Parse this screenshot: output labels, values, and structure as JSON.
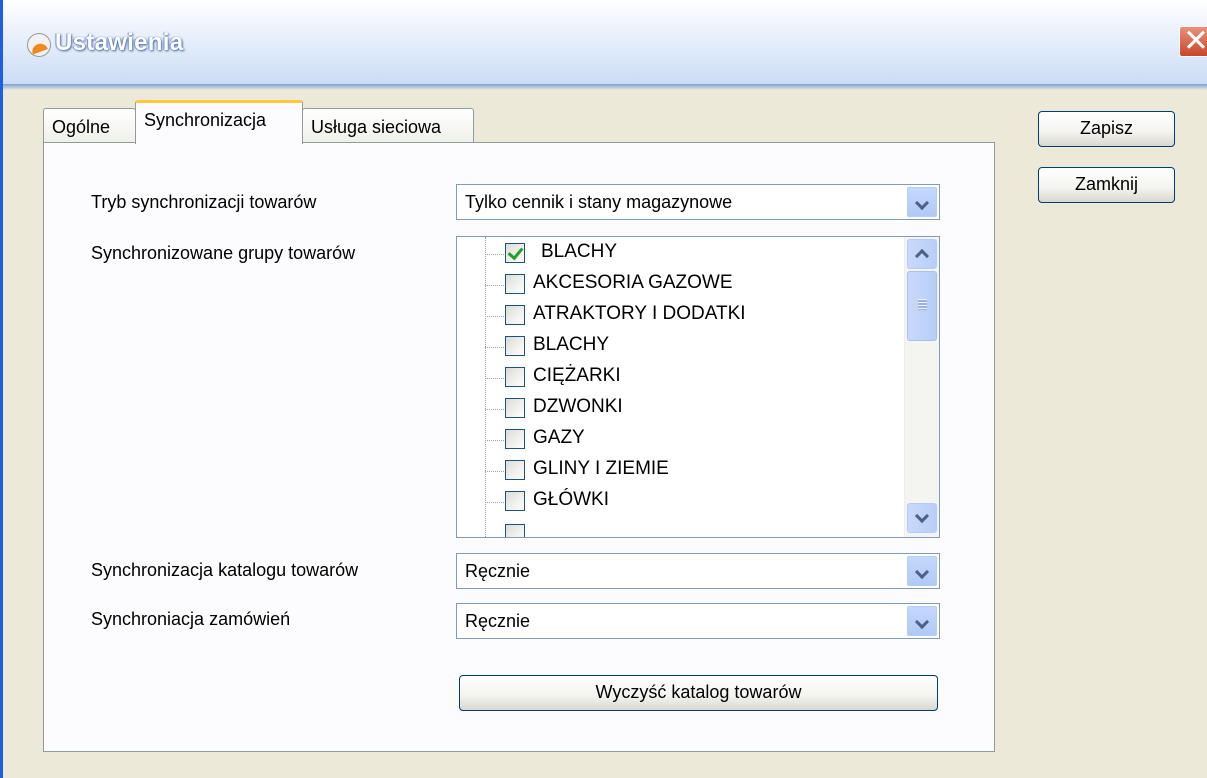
{
  "window": {
    "title": "Ustawienia",
    "close_glyph": "✕"
  },
  "tabs": [
    {
      "label": "Ogólne"
    },
    {
      "label": "Synchronizacja",
      "selected": true
    },
    {
      "label": "Usługa sieciowa"
    }
  ],
  "form": {
    "sync_mode": {
      "label": "Tryb synchronizacji towarów",
      "value": "Tylko cennik i stany magazynowe"
    },
    "groups": {
      "label": "Synchronizowane grupy towarów",
      "items": [
        {
          "label": "BLACHY",
          "checked": true
        },
        {
          "label": "AKCESORIA GAZOWE",
          "checked": false
        },
        {
          "label": "ATRAKTORY I DODATKI",
          "checked": false
        },
        {
          "label": "BLACHY",
          "checked": false
        },
        {
          "label": "CIĘŻARKI",
          "checked": false
        },
        {
          "label": "DZWONKI",
          "checked": false
        },
        {
          "label": "GAZY",
          "checked": false
        },
        {
          "label": "GLINY I ZIEMIE",
          "checked": false
        },
        {
          "label": "GŁÓWKI",
          "checked": false
        }
      ]
    },
    "catalog_sync": {
      "label": "Synchronizacja katalogu towarów",
      "value": "Ręcznie"
    },
    "orders_sync": {
      "label": "Synchroniacja zamówień",
      "value": "Ręcznie"
    },
    "clear_catalog_label": "Wyczyść katalog towarów"
  },
  "buttons": {
    "save": "Zapisz",
    "close": "Zamknij"
  },
  "colors": {
    "titlebar": "#c8daf5",
    "dialog_bg": "#ece9d8",
    "active_tab_accent": "#ffc73c",
    "check_mark": "#21a121"
  },
  "icons": {
    "app": "app-logo-icon",
    "close": "close-icon",
    "dropdown": "chevron-down-icon",
    "scroll_up": "chevron-up-icon",
    "scroll_down": "chevron-down-icon"
  }
}
